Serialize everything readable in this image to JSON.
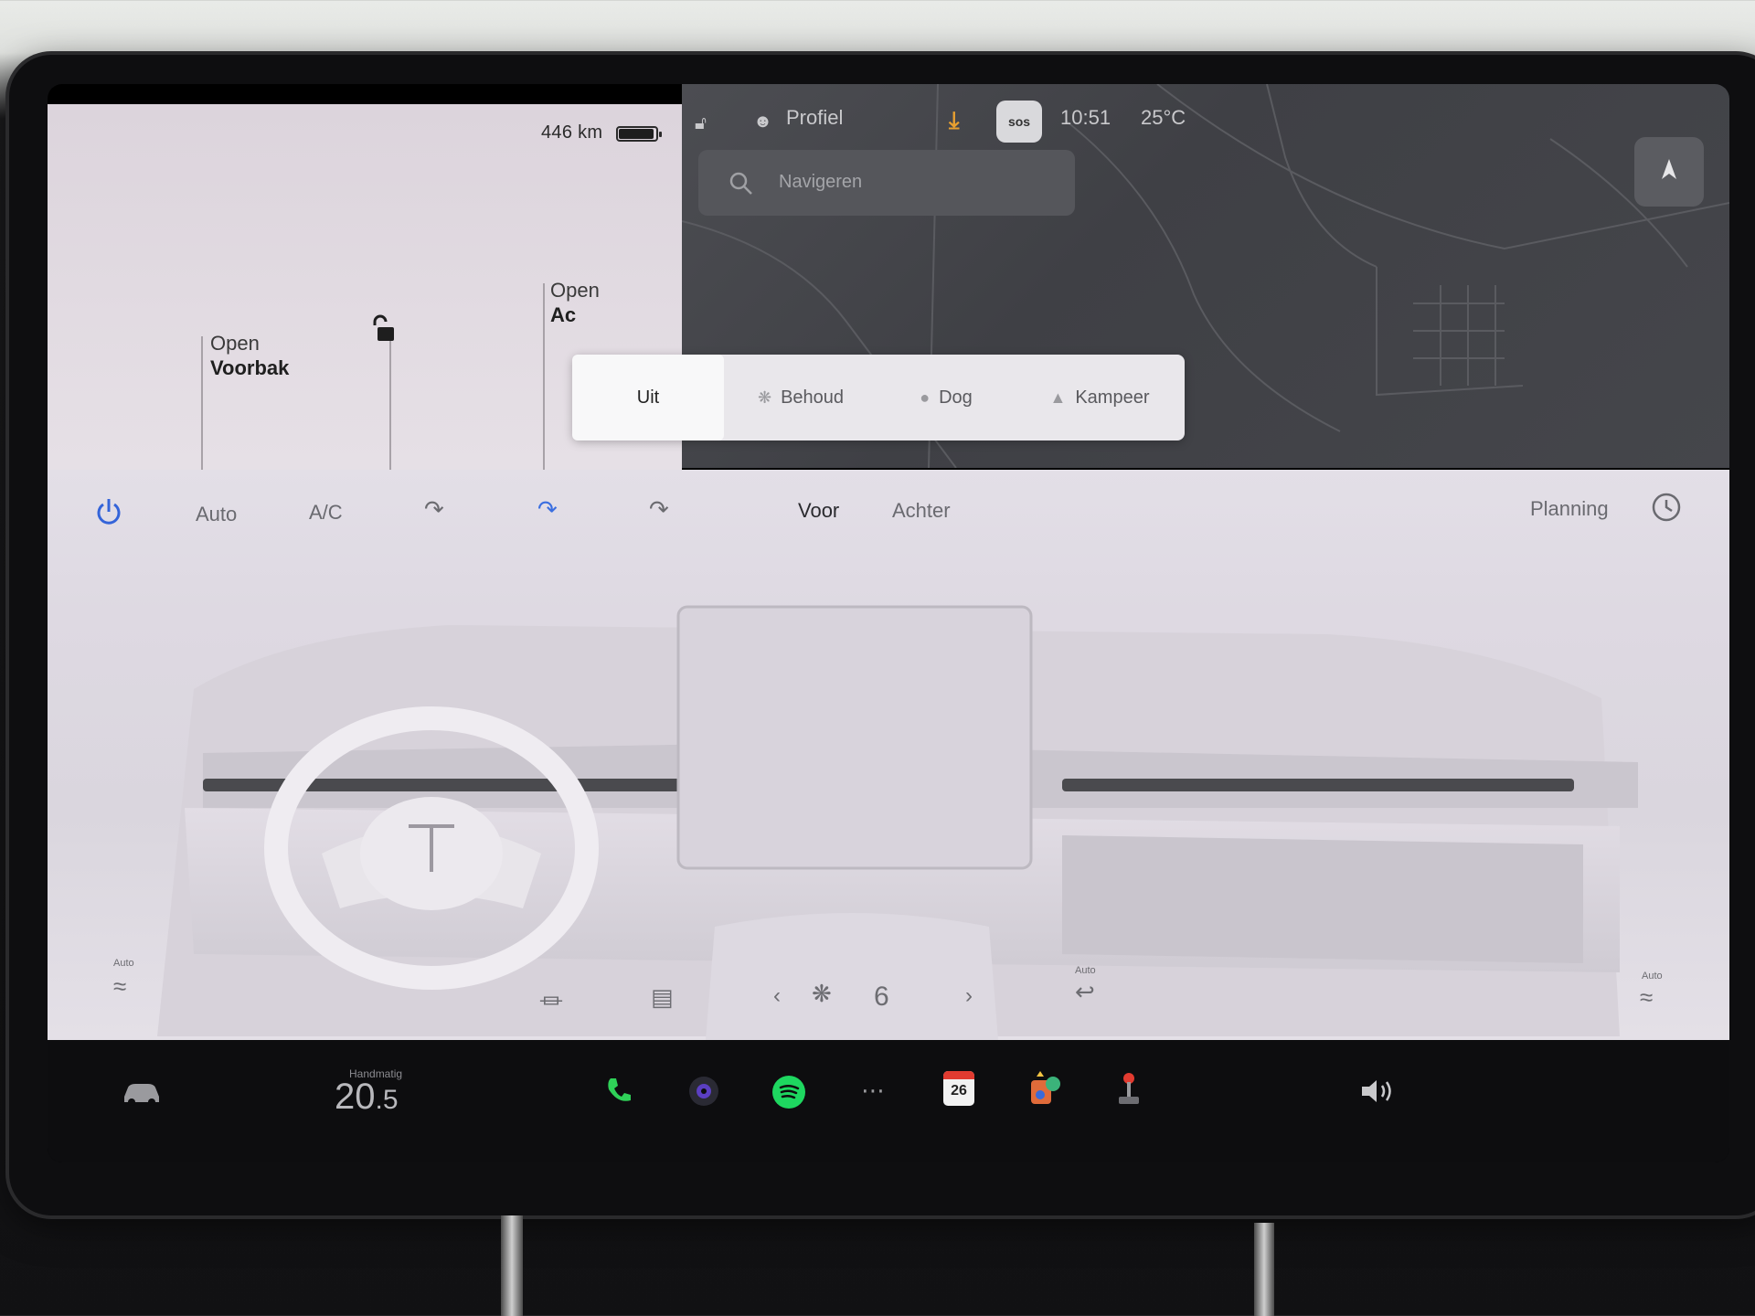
{
  "status_bar": {
    "range": "446 km",
    "profile_label": "Profiel",
    "sos_label": "sos",
    "time": "10:51",
    "temperature": "25°C"
  },
  "vehicle": {
    "frunk_open": "Open",
    "frunk_name": "Voorbak",
    "trunk_open": "Open",
    "trunk_name_partial": "Ac"
  },
  "map": {
    "search_placeholder": "Navigeren"
  },
  "keep_climate_modes": [
    {
      "label": "Uit",
      "icon": "none",
      "selected": true
    },
    {
      "label": "Behoud",
      "icon": "fan-icon",
      "selected": false
    },
    {
      "label": "Dog",
      "icon": "paw-icon",
      "selected": false
    },
    {
      "label": "Kampeer",
      "icon": "tent-icon",
      "selected": false
    }
  ],
  "climate": {
    "auto_label": "Auto",
    "ac_label": "A/C",
    "front_label": "Voor",
    "rear_label": "Achter",
    "schedule_label": "Planning",
    "fan_speed": "6",
    "seat_left_auto": "Auto",
    "seat_right_auto": "Auto",
    "recirc_auto": "Auto"
  },
  "taskbar": {
    "temp_mode": "Handmatig",
    "temp_whole": "20",
    "temp_decimal": ".5",
    "calendar_day": "26"
  },
  "colors": {
    "accent_blue": "#3464d9",
    "spotify_green": "#1ed760",
    "phone_green": "#2fd158",
    "download_orange": "#e8a030"
  }
}
